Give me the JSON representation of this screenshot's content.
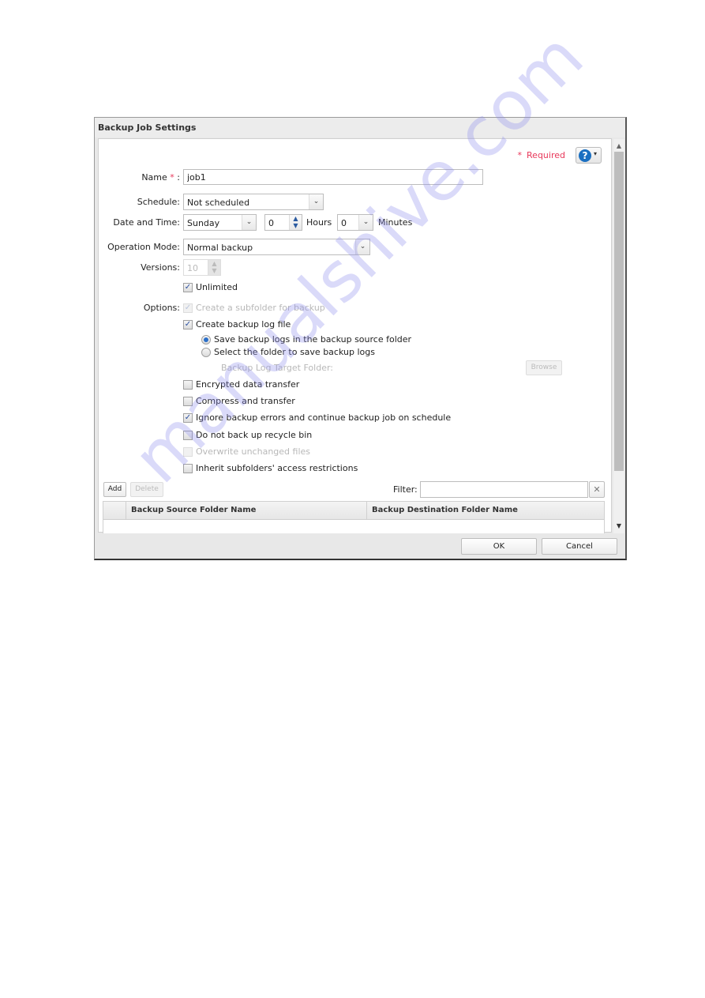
{
  "dialog": {
    "title": "Backup Job Settings",
    "required_star": "*",
    "required_label": "Required",
    "help_icon": "question-circle-icon",
    "help_symbol": "?",
    "help_caret": "▾"
  },
  "form": {
    "name": {
      "label": "Name",
      "required_mark": "*",
      "colon": ":",
      "value": "job1"
    },
    "schedule": {
      "label": "Schedule:",
      "value": "Not scheduled"
    },
    "date_time": {
      "label": "Date and Time:",
      "day": "Sunday",
      "hours_value": "0",
      "hours_label": "Hours",
      "minutes_value": "0",
      "minutes_label": "Minutes"
    },
    "operation_mode": {
      "label": "Operation Mode:",
      "value": "Normal backup"
    },
    "versions": {
      "label": "Versions:",
      "value": "10",
      "disabled": true
    },
    "unlimited": {
      "label": "Unlimited",
      "checked": true
    },
    "options_label": "Options:",
    "options": [
      {
        "label": "Create a subfolder for backup",
        "checked": true,
        "disabled": true
      },
      {
        "label": "Create backup log file",
        "checked": true,
        "disabled": false
      }
    ],
    "log_location": [
      {
        "label": "Save backup logs in the backup source folder",
        "selected": true
      },
      {
        "label": "Select the folder to save backup logs",
        "selected": false
      }
    ],
    "log_target_folder_label": "Backup Log Target Folder:",
    "browse_label": "Browse",
    "more_options": [
      {
        "label": "Encrypted data transfer",
        "checked": false,
        "disabled": false
      },
      {
        "label": "Compress and transfer",
        "checked": false,
        "disabled": false
      },
      {
        "label": "Ignore backup errors and continue backup job on schedule",
        "checked": true,
        "disabled": false
      },
      {
        "label": "Do not back up recycle bin",
        "checked": false,
        "disabled": false
      },
      {
        "label": "Overwrite unchanged files",
        "checked": false,
        "disabled": true
      },
      {
        "label": "Inherit subfolders' access restrictions",
        "checked": false,
        "disabled": false
      }
    ]
  },
  "folders": {
    "add_label": "Add",
    "delete_label": "Delete",
    "filter_label": "Filter:",
    "filter_value": "",
    "clear_symbol": "✕",
    "columns": [
      "Backup Source Folder Name",
      "Backup Destination Folder Name"
    ],
    "rows": []
  },
  "footer": {
    "ok_label": "OK",
    "cancel_label": "Cancel"
  },
  "scroll": {
    "up_symbol": "▲",
    "down_symbol": "▼"
  },
  "watermark": "manualshive.com",
  "glyphs": {
    "check": "✓",
    "chevron_down": "⌄",
    "spin": "⌃⌄"
  }
}
